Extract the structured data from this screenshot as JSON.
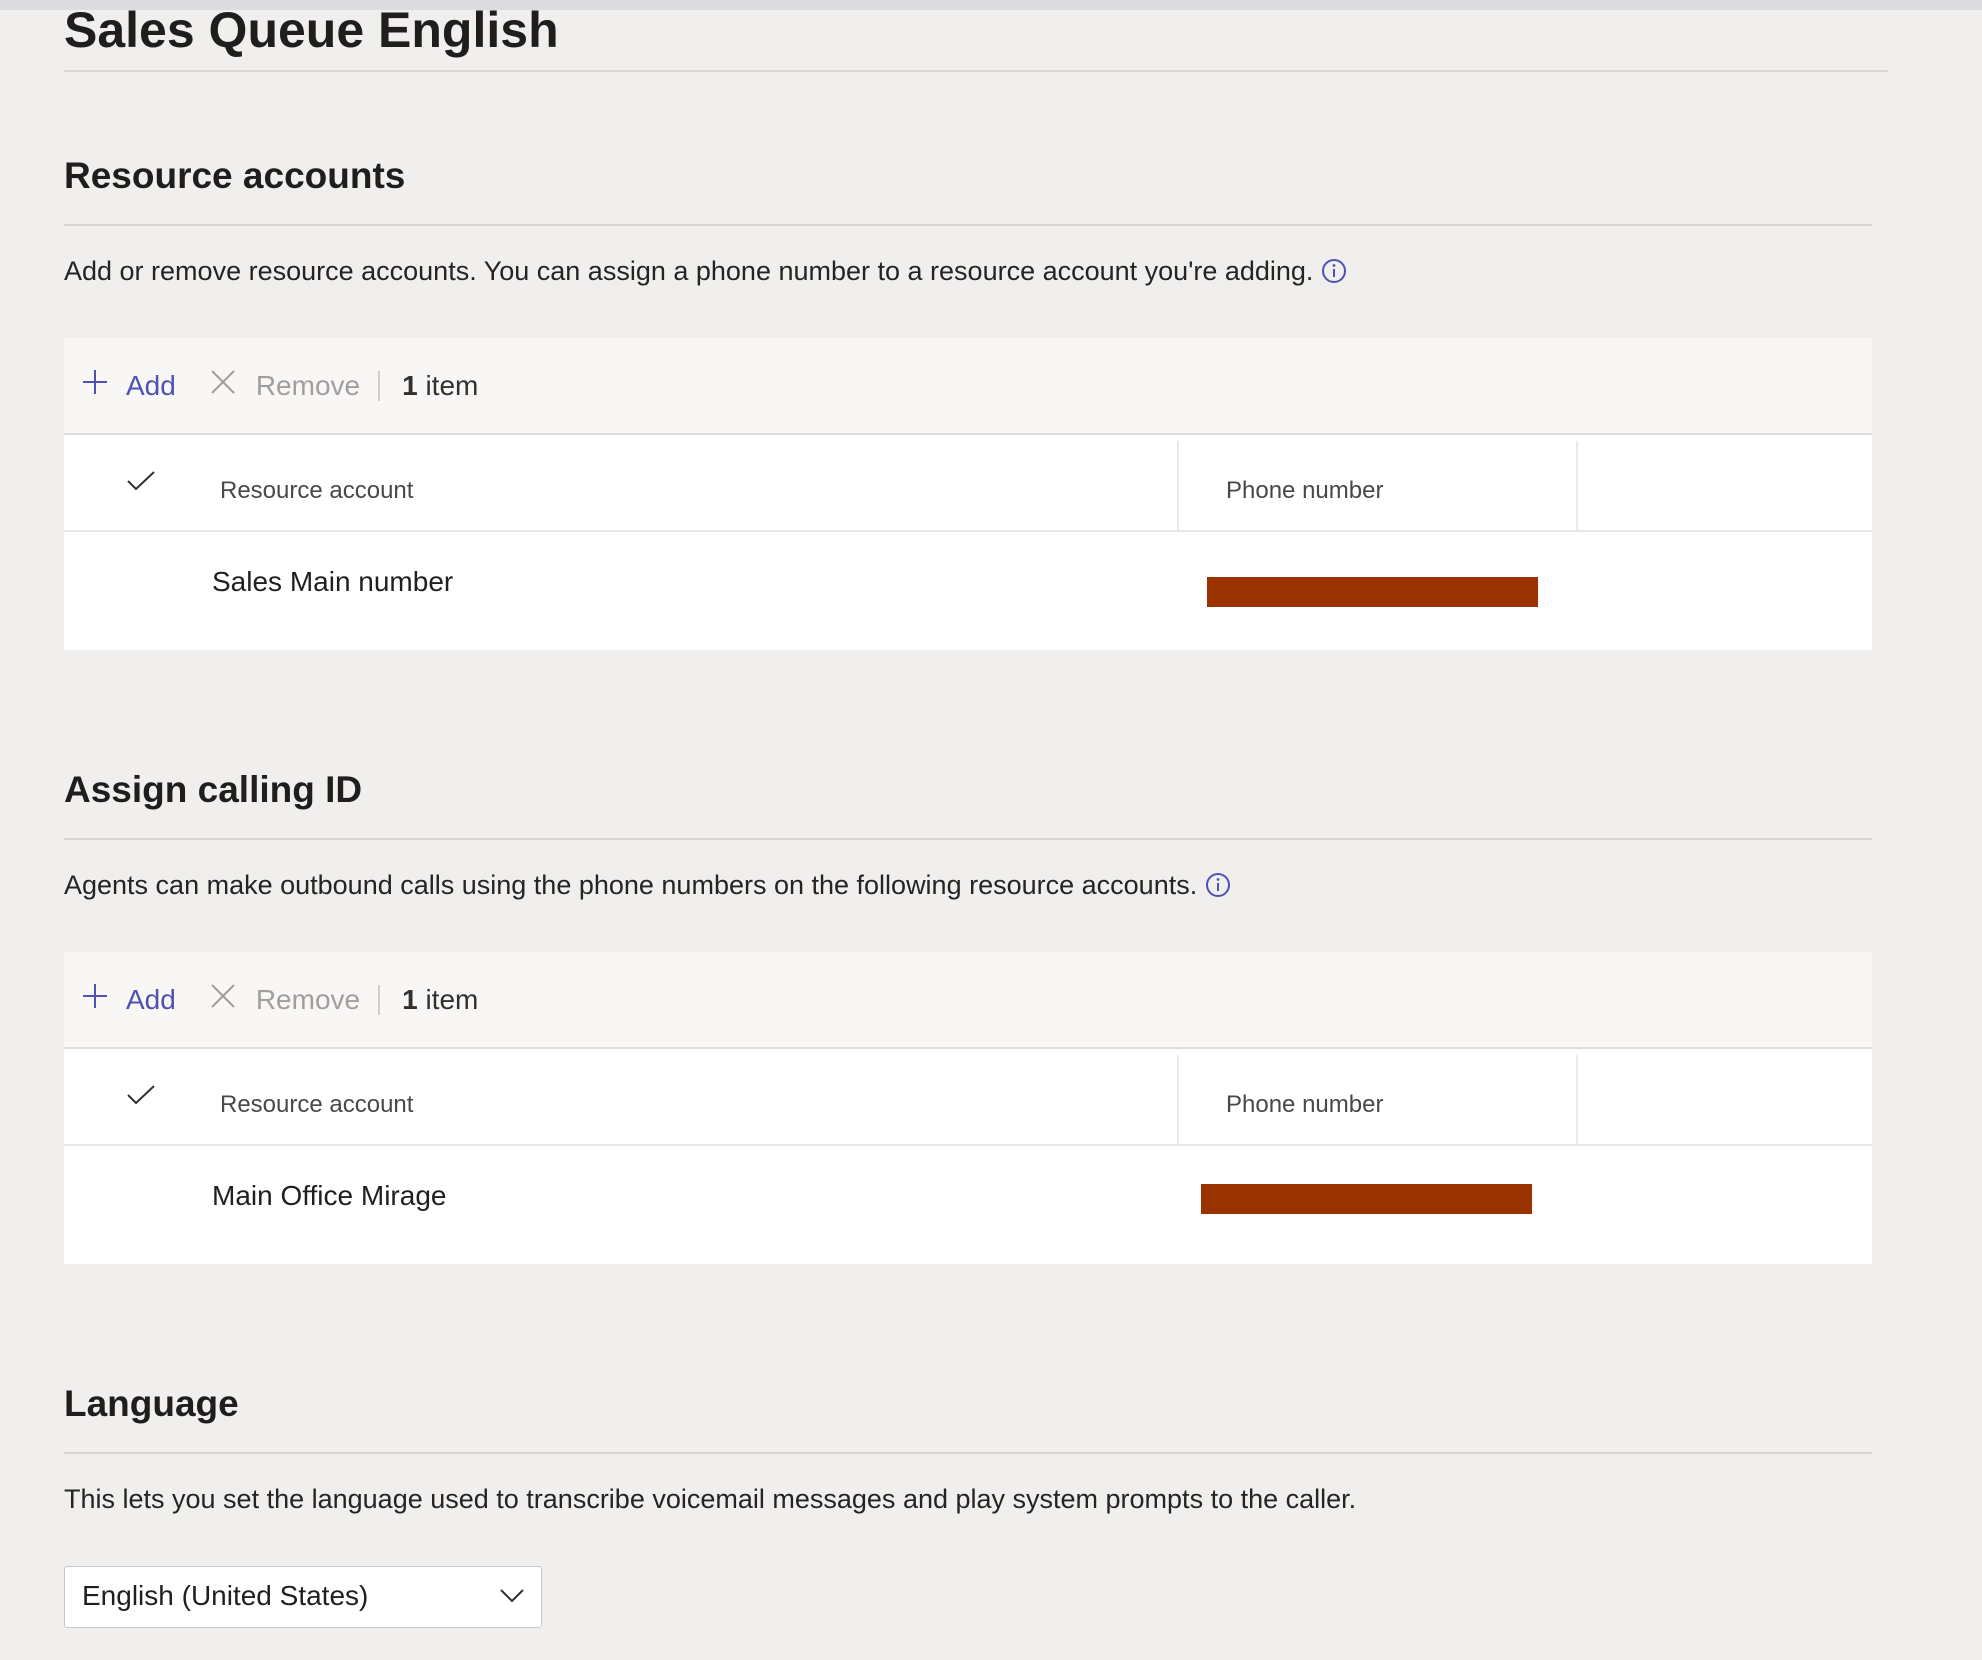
{
  "page": {
    "title": "Sales Queue English"
  },
  "resource_accounts": {
    "heading": "Resource accounts",
    "description": "Add or remove resource accounts. You can assign a phone number to a resource account you're adding.",
    "toolbar": {
      "add_label": "Add",
      "remove_label": "Remove",
      "count_number": "1",
      "count_suffix": "item"
    },
    "columns": [
      "Resource account",
      "Phone number"
    ],
    "rows": [
      {
        "resource_account": "Sales Main number",
        "phone_number_redacted": true
      }
    ]
  },
  "calling_id": {
    "heading": "Assign calling ID",
    "description": "Agents can make outbound calls using the phone numbers on the following resource accounts.",
    "toolbar": {
      "add_label": "Add",
      "remove_label": "Remove",
      "count_number": "1",
      "count_suffix": "item"
    },
    "columns": [
      "Resource account",
      "Phone number"
    ],
    "rows": [
      {
        "resource_account": "Main Office Mirage",
        "phone_number_redacted": true
      }
    ]
  },
  "language": {
    "heading": "Language",
    "description": "This lets you set the language used to transcribe voicemail messages and play system prompts to the caller.",
    "selected": "English (United States)"
  },
  "icons": {
    "info": "info-icon",
    "add": "plus-icon",
    "remove": "close-icon",
    "check": "checkmark-icon",
    "dropdown": "chevron-down-icon"
  },
  "colors": {
    "accent": "#4f52b2",
    "disabled_text": "#a19f9d",
    "redaction": "#9b3300",
    "background": "#f0efee",
    "toolbar_bg": "#f8f7f6"
  }
}
